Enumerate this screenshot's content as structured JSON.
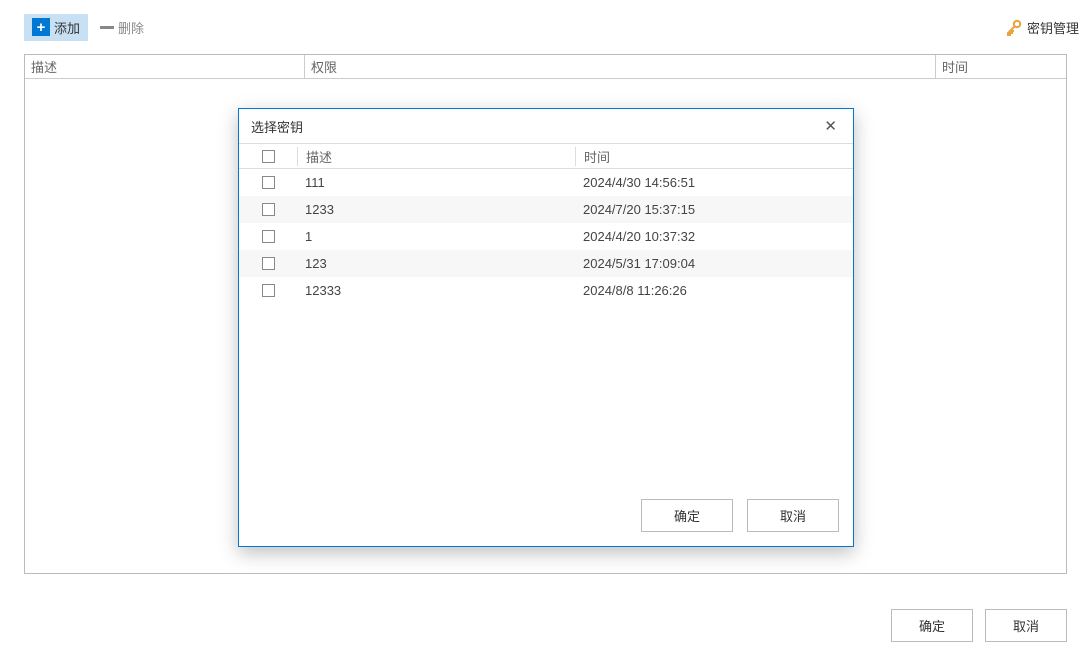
{
  "toolbar": {
    "add_label": "添加",
    "delete_label": "删除",
    "key_manage_label": "密钥管理"
  },
  "main_table": {
    "col_desc": "描述",
    "col_perm": "权限",
    "col_time": "时间"
  },
  "dialog": {
    "title": "选择密钥",
    "col_desc": "描述",
    "col_time": "时间",
    "rows": [
      {
        "desc": "111",
        "time": "2024/4/30 14:56:51"
      },
      {
        "desc": "1233",
        "time": "2024/7/20 15:37:15"
      },
      {
        "desc": "1",
        "time": "2024/4/20 10:37:32"
      },
      {
        "desc": "123",
        "time": "2024/5/31 17:09:04"
      },
      {
        "desc": "12333",
        "time": "2024/8/8 11:26:26"
      }
    ],
    "ok_label": "确定",
    "cancel_label": "取消"
  },
  "footer": {
    "ok_label": "确定",
    "cancel_label": "取消"
  }
}
